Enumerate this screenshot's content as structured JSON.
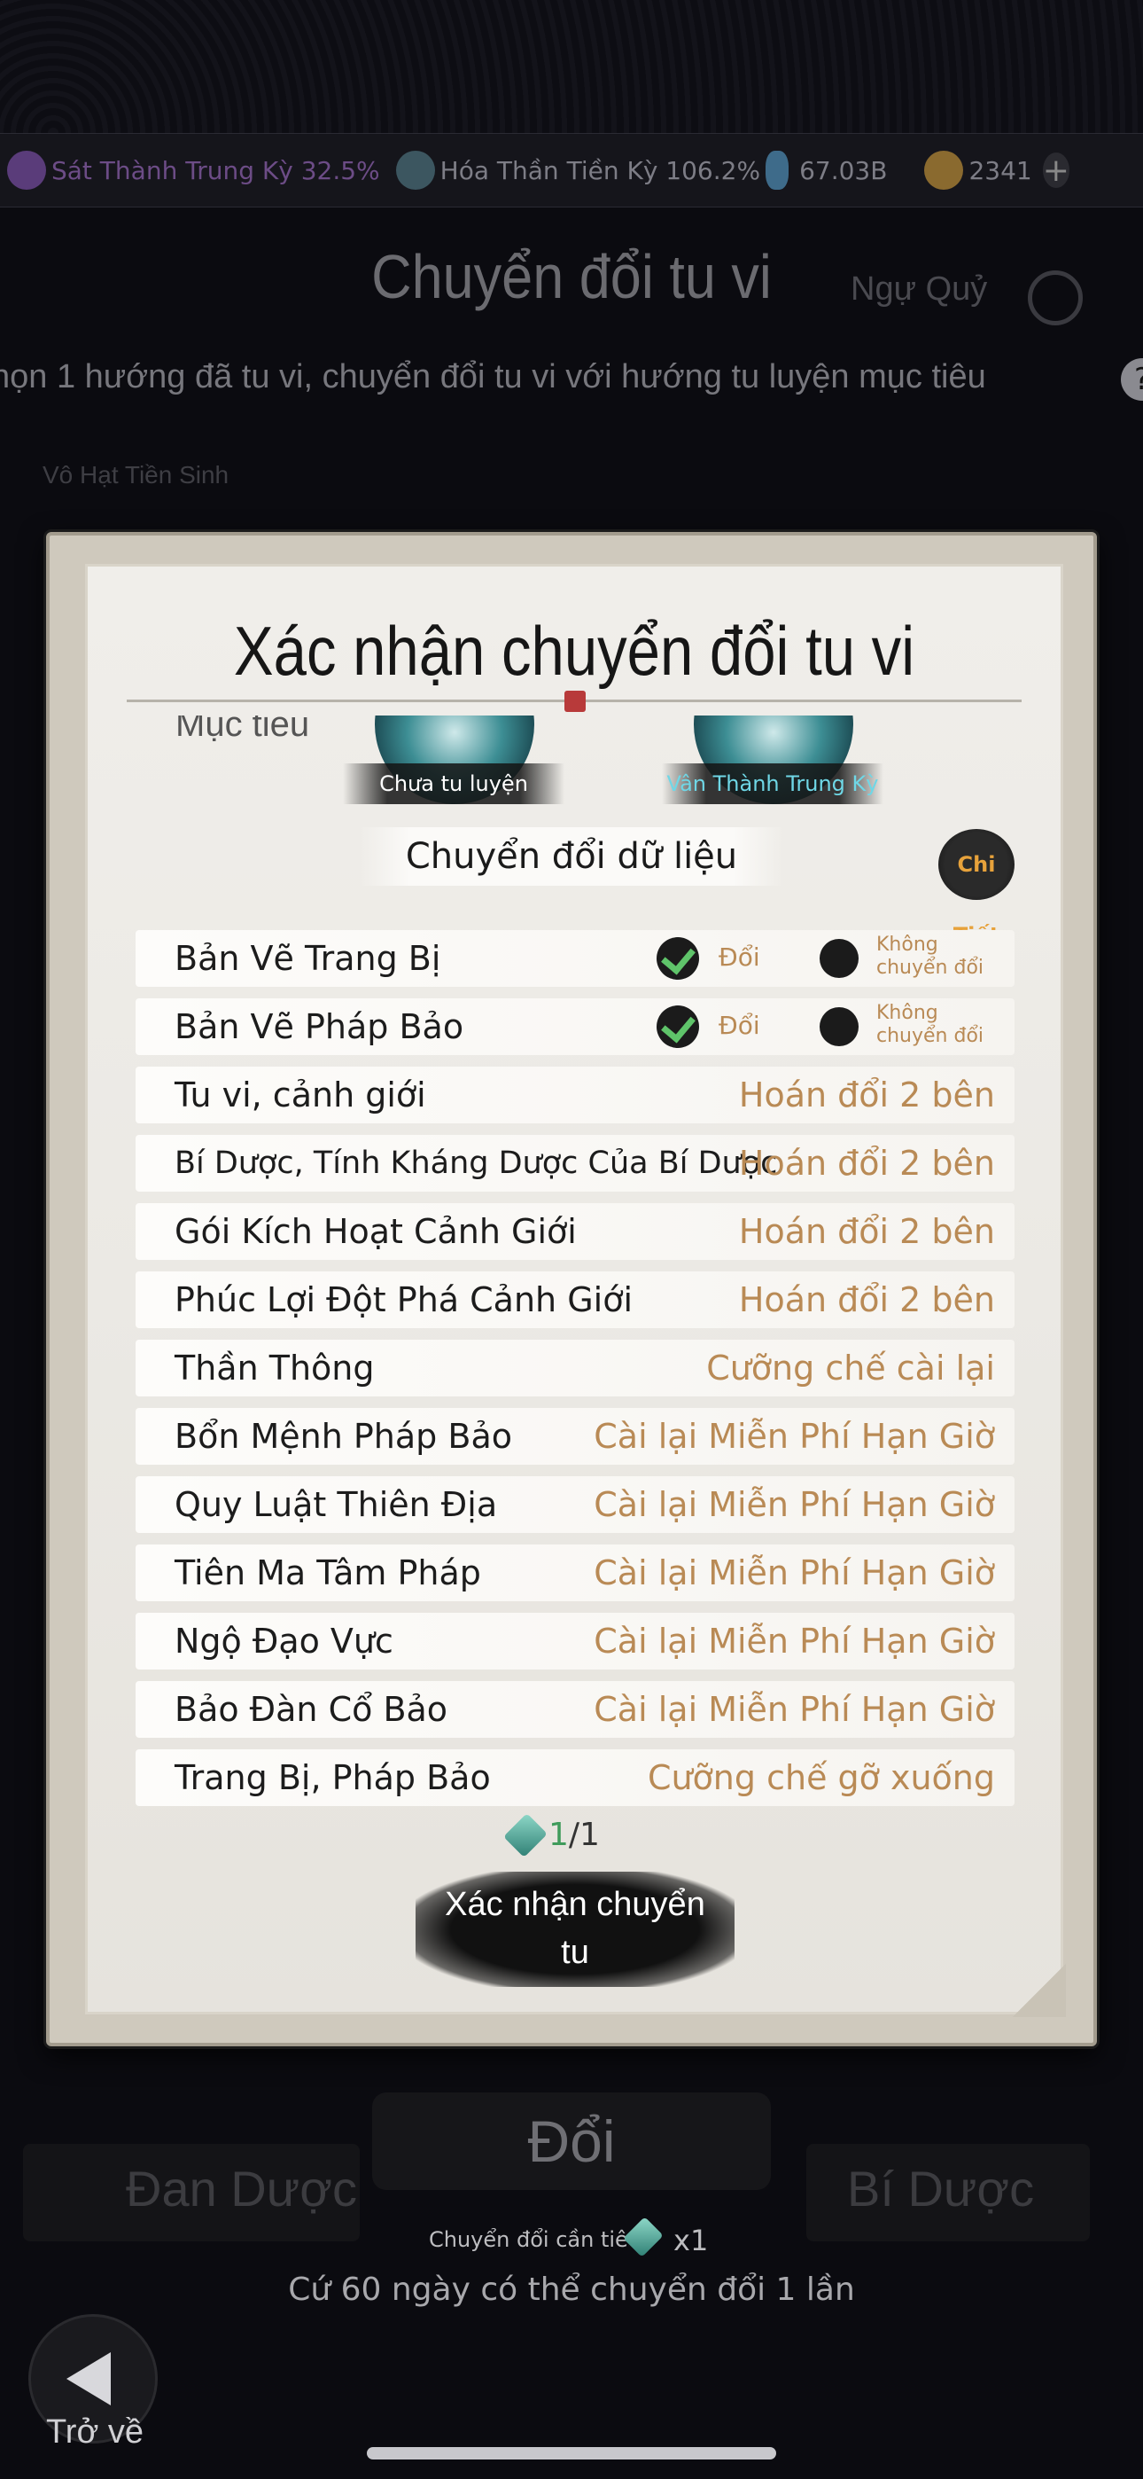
{
  "status_bar": {
    "realm_1": "Sát Thành Trung Kỳ 32.5%",
    "realm_2": "Hóa Thần Tiền Kỳ 106.2%",
    "currency_1": "67.03B",
    "currency_2": "2341",
    "add_symbol": "+"
  },
  "background": {
    "title": "Chuyển đổi tu vi",
    "tab_right": "Ngự Quỷ",
    "subtitle": "họn 1 hướng đã tu vi, chuyển đổi tu vi với hướng tu luyện mục tiêu",
    "path_label": "Vô Hạt Tiền Sinh",
    "left_tab": "Đan Dược",
    "right_tab": "Bí Dược",
    "swap_button": "Đổi",
    "cost_note": "Chuyển đổi cần tiêu",
    "cost_qty": "x1",
    "rule_text": "Cứ 60 ngày có thể chuyển đổi 1 lần",
    "back_label": "Trở về",
    "help_symbol": "?"
  },
  "dialog": {
    "title": "Xác nhận chuyển đổi tu vi",
    "target_label": "Mục tiêu",
    "orb_left_caption": "Chưa tu luyện",
    "orb_right_caption": "Vân Thành Trung Kỳ",
    "section_title": "Chuyển đổi dữ liệu",
    "details_button": "Chi Tiết",
    "option_swap": "Đổi",
    "option_no_swap": "Không chuyển đổi",
    "rows": [
      {
        "label": "Bản Vẽ Trang Bị",
        "value": ""
      },
      {
        "label": "Bản Vẽ Pháp Bảo",
        "value": ""
      },
      {
        "label": "Tu vi, cảnh giới",
        "value": "Hoán đổi 2 bên"
      },
      {
        "label": "Bí Dược, Tính Kháng Dược Của Bí Dược",
        "value": "Hoán đổi 2 bên"
      },
      {
        "label": "Gói Kích Hoạt Cảnh Giới",
        "value": "Hoán đổi 2 bên"
      },
      {
        "label": "Phúc Lợi Đột Phá Cảnh Giới",
        "value": "Hoán đổi 2 bên"
      },
      {
        "label": "Thần Thông",
        "value": "Cưỡng chế cài lại"
      },
      {
        "label": "Bổn Mệnh Pháp Bảo",
        "value": "Cài lại Miễn Phí Hạn Giờ"
      },
      {
        "label": "Quy Luật Thiên Địa",
        "value": "Cài lại Miễn Phí Hạn Giờ"
      },
      {
        "label": "Tiên Ma Tâm Pháp",
        "value": "Cài lại Miễn Phí Hạn Giờ"
      },
      {
        "label": "Ngộ Đạo Vực",
        "value": "Cài lại Miễn Phí Hạn Giờ"
      },
      {
        "label": "Bảo Đàn Cổ Bảo",
        "value": "Cài lại Miễn Phí Hạn Giờ"
      },
      {
        "label": "Trang Bị, Pháp Bảo",
        "value": "Cưỡng chế gỡ xuống"
      }
    ],
    "cost_have": "1",
    "cost_sep": "/1",
    "confirm_line1": "Xác nhận chuyển",
    "confirm_line2": "tu"
  },
  "colors": {
    "accent_value": "#b98a55",
    "check_green": "#5fc46a"
  }
}
